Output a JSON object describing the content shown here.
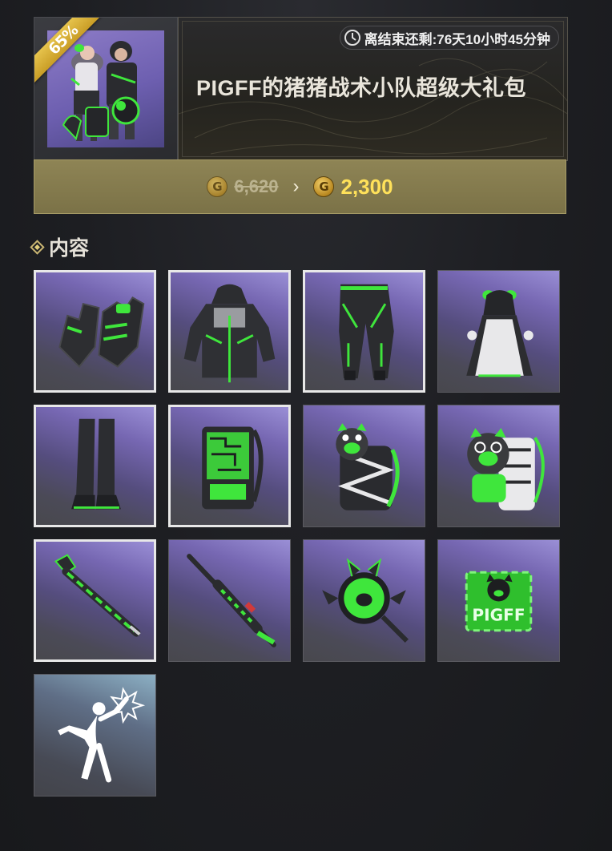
{
  "bundle": {
    "discount_badge": "65%",
    "timer_text": "离结束还剩:76天10小时45分钟",
    "title": "PIGFF的猪猪战术小队超级大礼包",
    "original_price": "6,620",
    "sale_price": "2,300",
    "currency_icon": "G"
  },
  "contents": {
    "section_title": "内容",
    "items": [
      {
        "name": "gloves"
      },
      {
        "name": "hooded-jacket"
      },
      {
        "name": "pants"
      },
      {
        "name": "maid-outfit"
      },
      {
        "name": "stockings-boots"
      },
      {
        "name": "tech-backpack"
      },
      {
        "name": "pig-backpack-dark"
      },
      {
        "name": "pig-backpack-green"
      },
      {
        "name": "melee-weapon"
      },
      {
        "name": "sniper-rifle"
      },
      {
        "name": "pan-emblem"
      },
      {
        "name": "pigff-spray",
        "label": "PIGFF"
      },
      {
        "name": "emote"
      }
    ]
  },
  "colors": {
    "accent_green": "#3fe63c",
    "price_gold": "#ffe15a",
    "panel_gold": "#8e8455"
  }
}
